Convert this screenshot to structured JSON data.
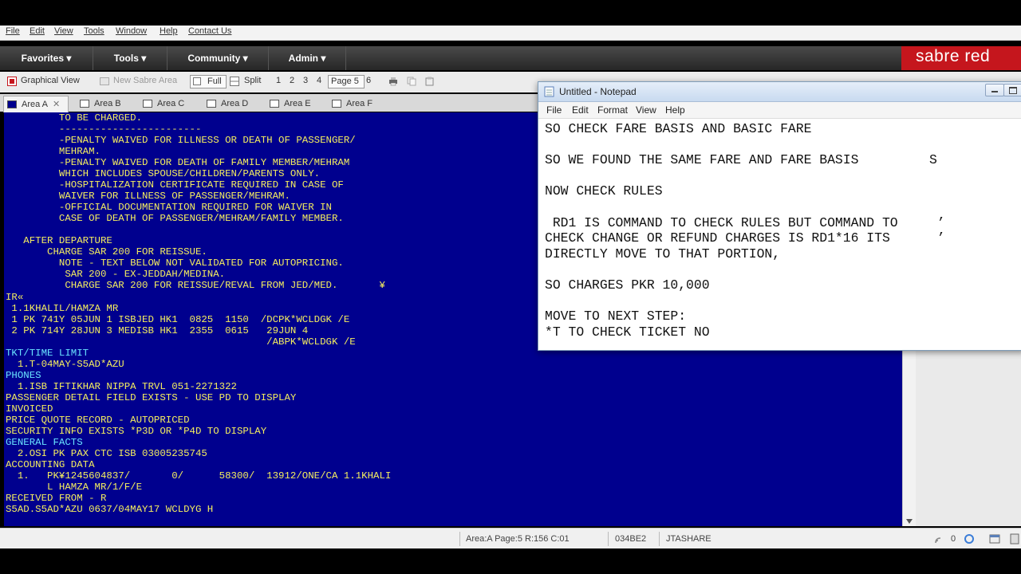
{
  "menubar": [
    "File",
    "Edit",
    "View",
    "Tools",
    "Window",
    "Help",
    "Contact Us"
  ],
  "nav": {
    "items": [
      "Favorites ▾",
      "Tools ▾",
      "Community ▾",
      "Admin ▾"
    ],
    "brand": "sabre red"
  },
  "toolbar": {
    "graphical_view": "Graphical View",
    "new_area": "New Sabre Area",
    "full": "Full",
    "split": "Split",
    "pages": [
      "1",
      "2",
      "3",
      "4"
    ],
    "current_page": "Page 5",
    "page6": "6"
  },
  "tabs": [
    "Area A",
    "Area B",
    "Area C",
    "Area D",
    "Area E",
    "Area F"
  ],
  "terminal": {
    "lines": [
      {
        "t": "         TO BE CHARGED.",
        "c": "y"
      },
      {
        "t": "         ------------------------",
        "c": "y"
      },
      {
        "t": "         -PENALTY WAIVED FOR ILLNESS OR DEATH OF PASSENGER/",
        "c": "y"
      },
      {
        "t": "         MEHRAM.",
        "c": "y"
      },
      {
        "t": "         -PENALTY WAIVED FOR DEATH OF FAMILY MEMBER/MEHRAM",
        "c": "y"
      },
      {
        "t": "         WHICH INCLUDES SPOUSE/CHILDREN/PARENTS ONLY.",
        "c": "y"
      },
      {
        "t": "         -HOSPITALIZATION CERTIFICATE REQUIRED IN CASE OF",
        "c": "y"
      },
      {
        "t": "         WAIVER FOR ILLNESS OF PASSENGER/MEHRAM.",
        "c": "y"
      },
      {
        "t": "         -OFFICIAL DOCUMENTATION REQUIRED FOR WAIVER IN",
        "c": "y"
      },
      {
        "t": "         CASE OF DEATH OF PASSENGER/MEHRAM/FAMILY MEMBER.",
        "c": "y"
      },
      {
        "t": "",
        "c": "y"
      },
      {
        "t": "   AFTER DEPARTURE",
        "c": "y"
      },
      {
        "t": "       CHARGE SAR 200 FOR REISSUE.",
        "c": "y"
      },
      {
        "t": "         NOTE - TEXT BELOW NOT VALIDATED FOR AUTOPRICING.",
        "c": "y"
      },
      {
        "t": "          SAR 200 - EX-JEDDAH/MEDINA.",
        "c": "y"
      },
      {
        "t": "          CHARGE SAR 200 FOR REISSUE/REVAL FROM JED/MED.       ¥",
        "c": "y"
      },
      {
        "t": "IR«",
        "c": "y"
      },
      {
        "t": " 1.1KHALIL/HAMZA MR",
        "c": "y"
      },
      {
        "t": " 1 PK 741Y 05JUN 1 ISBJED HK1  0825  1150  /DCPK*WCLDGK /E",
        "c": "y"
      },
      {
        "t": " 2 PK 714Y 28JUN 3 MEDISB HK1  2355  0615   29JUN 4",
        "c": "y"
      },
      {
        "t": "                                            /ABPK*WCLDGK /E",
        "c": "y"
      },
      {
        "t": "TKT/TIME LIMIT",
        "c": "c"
      },
      {
        "t": "  1.T-04MAY-S5AD*AZU",
        "c": "y"
      },
      {
        "t": "PHONES",
        "c": "c"
      },
      {
        "t": "  1.ISB IFTIKHAR NIPPA TRVL 051-2271322",
        "c": "y"
      },
      {
        "t": "PASSENGER DETAIL FIELD EXISTS - USE PD TO DISPLAY",
        "c": "y"
      },
      {
        "t": "INVOICED",
        "c": "y"
      },
      {
        "t": "PRICE QUOTE RECORD - AUTOPRICED",
        "c": "y"
      },
      {
        "t": "SECURITY INFO EXISTS *P3D OR *P4D TO DISPLAY",
        "c": "y"
      },
      {
        "t": "GENERAL FACTS",
        "c": "c"
      },
      {
        "t": "  2.OSI PK PAX CTC ISB 03005235745",
        "c": "y"
      },
      {
        "t": "ACCOUNTING DATA",
        "c": "y"
      },
      {
        "t": "  1.   PK¥1245604837/       0/      58300/  13912/ONE/CA 1.1KHALI",
        "c": "y"
      },
      {
        "t": "       L HAMZA MR/1/F/E",
        "c": "y"
      },
      {
        "t": "RECEIVED FROM - R",
        "c": "y"
      },
      {
        "t": "S5AD.S5AD*AZU 0637/04MAY17 WCLDYG H",
        "c": "y"
      }
    ]
  },
  "statusbar": {
    "area": "Area:A  Page:5  R:156  C:01",
    "code": "034BE2",
    "share": "JTASHARE",
    "count": "0"
  },
  "notepad": {
    "title": "Untitled - Notepad",
    "menu": [
      "File",
      "Edit",
      "Format",
      "View",
      "Help"
    ],
    "text": "SO CHECK FARE BASIS AND BASIC FARE\n\nSO WE FOUND THE SAME FARE AND FARE BASIS         S\n\nNOW CHECK RULES\n\n RD1 IS COMMAND TO CHECK RULES BUT COMMAND TO     ’\nCHECK CHANGE OR REFUND CHARGES IS RD1*16 ITS      ’\nDIRECTLY MOVE TO THAT PORTION,\n\nSO CHARGES PKR 10,000\n\nMOVE TO NEXT STEP:\n*T TO CHECK TICKET NO"
  },
  "colors": {
    "terminal_bg": "#00008e",
    "terminal_text": "#f5ee5f",
    "terminal_highlight": "#69e3ff",
    "brand_red": "#c5161d"
  }
}
